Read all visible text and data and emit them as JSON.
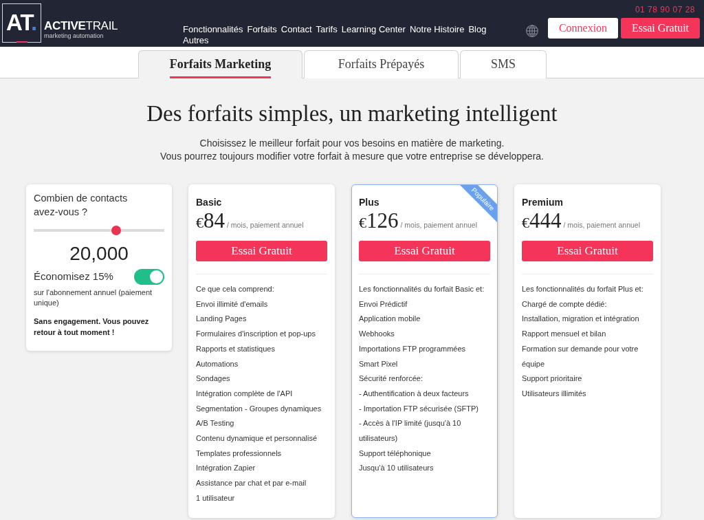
{
  "header": {
    "logo": {
      "mark": "AT",
      "mark_dot": ".",
      "name": "**ACTIVE**TRAIL",
      "tagline": "marketing automation"
    },
    "nav": [
      "Fonctionnalités",
      "Forfaits",
      "Contact",
      "Tarifs",
      "Learning Center",
      "Notre Histoire",
      "Blog",
      "Autres"
    ],
    "phone": "01 78 90 07 28",
    "buttons": [
      {
        "label": "Connexion",
        "kind": "outline"
      },
      {
        "label": "Essai Gratuit",
        "kind": "primary"
      }
    ]
  },
  "tabs": [
    {
      "label": "Forfaits Marketing",
      "selected": true
    },
    {
      "label": "Forfaits Prépayés",
      "selected": false
    },
    {
      "label": "SMS",
      "selected": false
    }
  ],
  "hero": {
    "title": "Des forfaits simples, un marketing intelligent",
    "subtitle": [
      "Choisissez le meilleur forfait pour vos besoins en matière de marketing.",
      "Vous pourrez toujours modifier votre forfait à mesure que votre entreprise se développera."
    ]
  },
  "contacts": {
    "question": "Combien de contacts avez-vous ?",
    "slider": {
      "level": 0.63
    },
    "count": "20,000",
    "discount": {
      "label": "Économisez 15%",
      "on": true
    },
    "discount_note": "sur l'abonnement annuel (paiement unique)",
    "notice": "Sans engagement. Vous pouvez retour à tout moment !"
  },
  "plans": [
    {
      "name": "Basic",
      "currency": "€",
      "price": "84",
      "period": "/ mois, paiement annuel",
      "button": "Essai Gratuit",
      "featured": false,
      "intro": "Ce que cela comprend:",
      "features": [
        "Envoi illimité d'emails",
        "Landing Pages",
        "Formulaires d'inscription et pop-ups",
        "Rapports et statistiques",
        "Automations",
        "Sondages",
        "Intégration complète de l'API",
        "Segmentation - Groupes dynamiques",
        "A/B Testing",
        "Contenu dynamique et personnalisé",
        "Templates professionnels",
        "Intégration Zapier",
        "Assistance par chat et par e-mail",
        "1 utilisateur"
      ]
    },
    {
      "name": "Plus",
      "currency": "€",
      "price": "126",
      "period": "/ mois, paiement annuel",
      "button": "Essai Gratuit",
      "featured": true,
      "ribbon": "Populaire",
      "intro": "Les fonctionnalités du forfait Basic et:",
      "features": [
        "Envoi Prédictif",
        "Application mobile",
        "Webhooks",
        "Importations FTP programmées",
        "Smart Pixel",
        "Sécurité renforcée:",
        "- Authentification à deux facteurs",
        "- Importation FTP sécurisée (SFTP)",
        "- Accès à l'IP limité (jusqu'à 10 utilisateurs)",
        "Support téléphonique",
        "Jusqu'à 10 utilisateurs"
      ]
    },
    {
      "name": "Premium",
      "currency": "€",
      "price": "444",
      "period": "/ mois, paiement annuel",
      "button": "Essai Gratuit",
      "featured": false,
      "intro": "Les fonctionnalités du forfait Plus et:",
      "features": [
        "Chargé de compte dédié:",
        "Installation, migration et intégration",
        "Rapport mensuel et bilan",
        "Formation sur demande pour votre équipe",
        "Support prioritaire",
        "Utilisateurs illimités"
      ]
    }
  ]
}
